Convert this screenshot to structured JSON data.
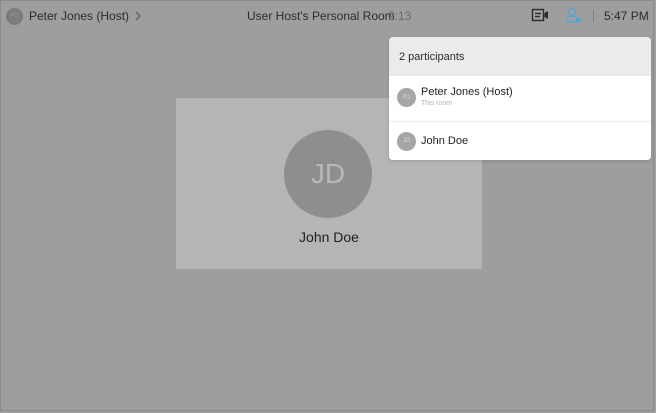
{
  "colors": {
    "background": "#9e9e9e",
    "tile": "#b5b5b5",
    "avatar": "#8e8e8e",
    "people_icon_accent": "#4da6d6",
    "panel": "#ffffff",
    "panel_header": "#ebebeb"
  },
  "topbar": {
    "host_avatar_initials": "PJ",
    "host_label": "Peter Jones (Host)",
    "meeting_title": "User Host's Personal Room",
    "meeting_timer": "2:13",
    "clock": "5:47 PM",
    "icons": [
      "chevron-right-icon",
      "layout-icon",
      "participants-icon"
    ]
  },
  "tile": {
    "initials": "JD",
    "name": "John Doe"
  },
  "participants_panel": {
    "header": "2 participants",
    "participants": [
      {
        "initials": "PJ",
        "name": "Peter Jones (Host)",
        "subtitle": "This room"
      },
      {
        "initials": "JD",
        "name": "John Doe",
        "subtitle": ""
      }
    ]
  }
}
